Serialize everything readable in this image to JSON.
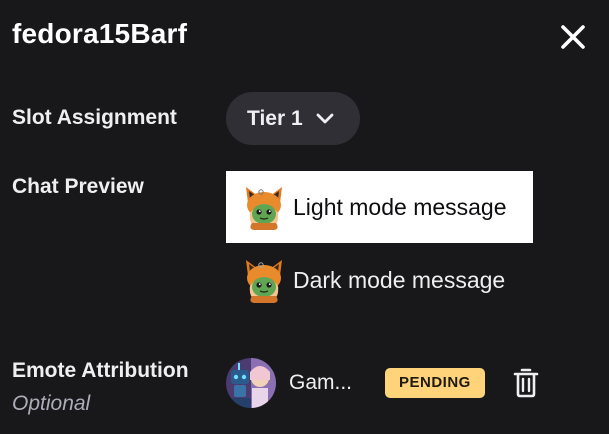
{
  "header": {
    "title": "fedora15Barf",
    "close_icon": "close-icon"
  },
  "slot_assignment": {
    "label": "Slot Assignment",
    "selected_value": "Tier 1",
    "chevron_icon": "chevron-down-icon"
  },
  "chat_preview": {
    "label": "Chat Preview",
    "light_message": "Light mode message",
    "dark_message": "Dark mode message",
    "emote_icon": "fox-emote-icon"
  },
  "emote_attribution": {
    "label": "Emote Attribution",
    "sublabel": "Optional",
    "creator_name": "Gam...",
    "status_badge": "PENDING",
    "delete_icon": "trash-icon"
  },
  "colors": {
    "background": "#18181b",
    "select_bg": "#2f2f35",
    "badge_bg": "#ffd37a",
    "muted_text": "#adadb8"
  }
}
